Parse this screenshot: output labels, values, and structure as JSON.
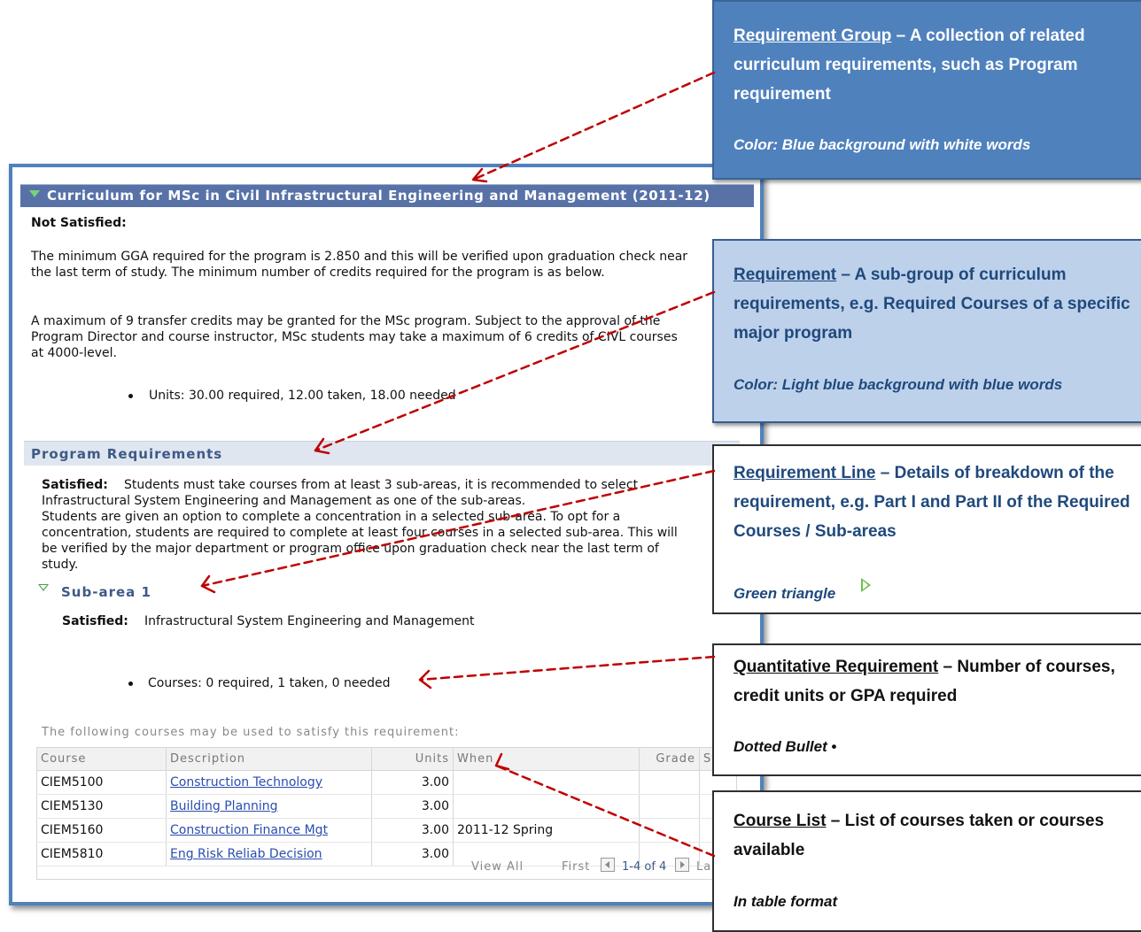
{
  "curriculum": {
    "group_title": "Curriculum for MSc in Civil Infrastructural Engineering and Management (2011-12)",
    "status_label": "Not Satisfied:",
    "description_lines": [
      "The minimum GGA required for the program is 2.850 and this will be verified upon graduation check near",
      "the last term of study. The minimum number of credits required for the program is as below."
    ],
    "transfer_lines": [
      "A maximum of 9 transfer credits may be granted for the MSc program. Subject to the approval of the",
      "Program Director and course instructor, MSc students may take a maximum of 6 credits of CIVL courses",
      "at 4000-level."
    ],
    "units_text": "Units: 30.00 required, 12.00 taken, 18.00 needed"
  },
  "program_requirements": {
    "title": "Program Requirements",
    "status_label": "Satisfied:",
    "text_lines": [
      "Students must take courses from at least 3 sub-areas, it is recommended to select",
      "Infrastructural System Engineering and Management as one of the sub-areas.",
      "Students are given an option to complete a concentration in a selected sub-area. To opt for a",
      "concentration, students are required to complete at least four courses in a selected sub-area. This will",
      "be verified by the major department or program office upon graduation check near the last term of",
      "study."
    ]
  },
  "sub_area": {
    "title": "Sub-area 1",
    "status_label": "Satisfied:",
    "status_text": "Infrastructural System Engineering and Management",
    "courses_text": "Courses: 0 required, 1 taken, 0 needed",
    "course_list_intro": "The following courses may be used to satisfy this requirement:"
  },
  "course_table": {
    "columns": [
      "Course",
      "Description",
      "Units",
      "When",
      "Grade",
      "Status"
    ],
    "rows": [
      {
        "course": "CIEM5100",
        "description": "Construction Technology",
        "units": "3.00",
        "when": "",
        "grade": "",
        "status": ""
      },
      {
        "course": "CIEM5130",
        "description": "Building Planning",
        "units": "3.00",
        "when": "",
        "grade": "",
        "status": ""
      },
      {
        "course": "CIEM5160",
        "description": "Construction Finance Mgt",
        "units": "3.00",
        "when": "2011-12 Spring",
        "grade": "",
        "status": "in-progress-diamond-icon"
      },
      {
        "course": "CIEM5810",
        "description": "Eng Risk Reliab Decision",
        "units": "3.00",
        "when": "",
        "grade": "",
        "status": ""
      }
    ],
    "footer": {
      "view_all": "View All",
      "first": "First",
      "range": "1-4 of 4",
      "last": "Last"
    }
  },
  "callouts": {
    "group": {
      "term": "Requirement Group",
      "definition": " – A collection of related curriculum requirements, such as Program requirement",
      "note": "Color: Blue background with white words"
    },
    "requirement": {
      "term": "Requirement",
      "definition": " – A sub-group of curriculum requirements, e.g. Required Courses of a specific major program",
      "note": "Color: Light blue background with blue words"
    },
    "line": {
      "term": "Requirement Line",
      "definition": " – Details of breakdown of the requirement, e.g. Part I and Part II of the Required Courses / Sub-areas",
      "note": "Green triangle"
    },
    "quantitative": {
      "term": "Quantitative Requirement",
      "definition": " – Number of courses, credit units or GPA required",
      "note": "Dotted Bullet",
      "note_symbol": "•"
    },
    "course_list": {
      "term": "Course List",
      "definition": " – List of courses taken or courses available",
      "note": "In table format"
    }
  },
  "colors": {
    "group_header_bg": "#5872a8",
    "requirement_header_bg": "#dfe6f0",
    "callout_blue": "#4f81bd",
    "callout_light_blue": "#bdd1ea",
    "arrow_red": "#c00000",
    "green_triangle": "#6fbf4a"
  }
}
